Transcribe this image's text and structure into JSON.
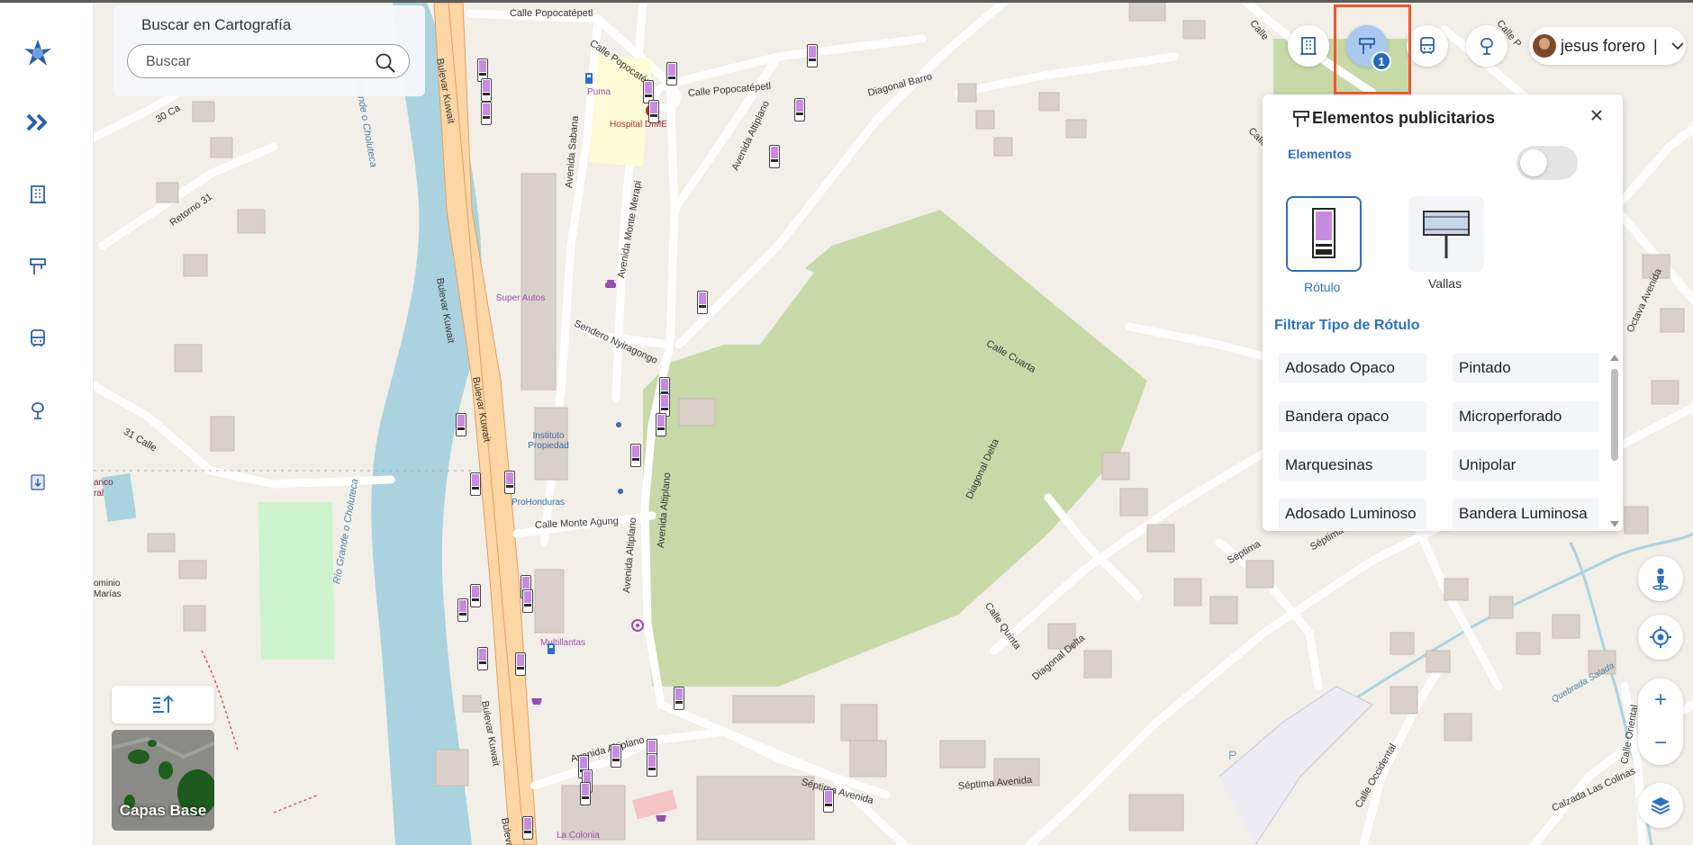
{
  "app": {
    "logo_icon": "app-logo-icon",
    "accent_color": "#2d6fc6",
    "highlight_color": "#f2552c"
  },
  "sidebar": {
    "items": [
      {
        "name": "expand",
        "icon": "double-chevron-right-icon"
      },
      {
        "name": "buildings",
        "icon": "building-icon"
      },
      {
        "name": "advertising",
        "icon": "signpost-icon"
      },
      {
        "name": "transport",
        "icon": "bus-icon"
      },
      {
        "name": "trees",
        "icon": "tree-icon"
      },
      {
        "name": "download",
        "icon": "download-icon"
      }
    ]
  },
  "search": {
    "title": "Buscar en Cartografía",
    "placeholder": "Buscar",
    "value": ""
  },
  "toolbar": {
    "buttons": [
      {
        "name": "buildings",
        "icon": "building-icon"
      },
      {
        "name": "advertising",
        "icon": "signpost-icon",
        "active": true,
        "badge": "1"
      },
      {
        "name": "transport",
        "icon": "bus-icon"
      },
      {
        "name": "trees",
        "icon": "tree-icon"
      }
    ]
  },
  "user": {
    "name": "jesus forero",
    "separator": "|"
  },
  "ad_panel": {
    "title": "Elementos publicitarios",
    "toggle_label": "Elementos",
    "toggle_on": false,
    "types": [
      {
        "label": "Rótulo",
        "selected": true
      },
      {
        "label": "Vallas",
        "selected": false
      }
    ],
    "filter_title": "Filtrar Tipo de Rótulo",
    "filters": [
      "Adosado Opaco",
      "Pintado",
      "Bandera opaco",
      "Microperforado",
      "Marquesinas",
      "Unipolar",
      "Adosado Luminoso",
      "Bandera Luminosa"
    ]
  },
  "map_controls": {
    "zoom_in": "+",
    "zoom_out": "−",
    "base_layers_label": "Capas Base"
  },
  "map_labels": {
    "streets": [
      "Calle Popocatépetl",
      "Calle Popocatép",
      "Calle Popocatépetl",
      "Diagonal Barro",
      "Avenida Altiplano",
      "Avenida Sabana",
      "Avenida Monte Merapi",
      "Sendero Nyiragongo",
      "Calle Cuarta",
      "Diagonal Delta",
      "Calle Quinta",
      "Séptima Avenida",
      "Octava Avenida",
      "Calle Monte Agung",
      "Avenida Altiplano",
      "Avenida Altiplano",
      "Séptima Avenida",
      "Calle Occidental",
      "Calle Oriental",
      "Calzada Las Colinas",
      "Bulevar Kuwait",
      "Bulevar Kuwait",
      "Bulevar Kuwait",
      "Bulevar Kuwait",
      "Bulevar Kuw",
      "Retorno 31",
      "31 Calle",
      "30 Ca",
      "Calle",
      "Calle P",
      "Calle",
      "Diagonal Delta",
      "Séptima",
      "Avenida Altiplano",
      "Séptima Avenida"
    ],
    "rivers": [
      "Río Grande o Choluteca",
      "Río Grande o Choluteca",
      "Quebrada Salada"
    ],
    "pois": [
      "Hospital DIME",
      "Super Autos",
      "Instituto Propiedad",
      "ProHonduras",
      "Multillantas",
      "La Colonia",
      "Puma"
    ],
    "misc": [
      "anco",
      "ral",
      "ominio",
      "Marías",
      "P"
    ]
  }
}
